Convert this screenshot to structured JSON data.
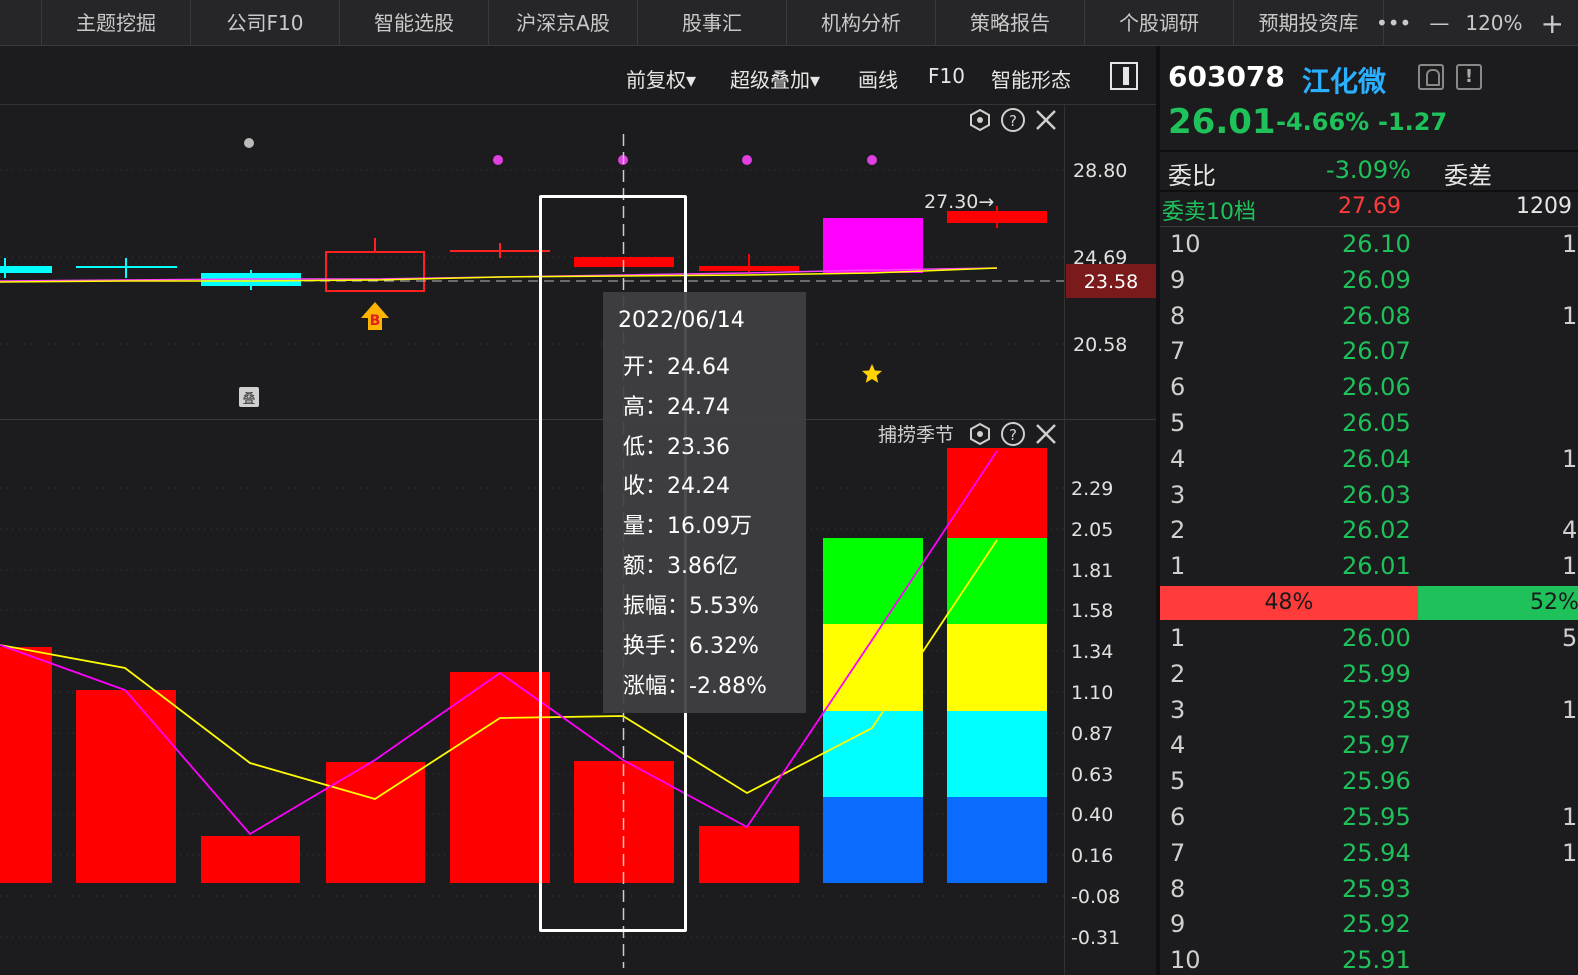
{
  "nav": {
    "tabs": [
      "主题挖掘",
      "公司F10",
      "智能选股",
      "沪深京A股",
      "股事汇",
      "机构分析",
      "策略报告",
      "个股调研",
      "预期投资库"
    ],
    "more": "•••",
    "zoom_out": "—",
    "zoom": "120%",
    "zoom_in": "+"
  },
  "toolbar": {
    "adjust": "前复权▾",
    "overlay": "超级叠加▾",
    "draw": "画线",
    "f10": "F10",
    "pattern": "智能形态"
  },
  "price_panel": {
    "y_ticks": [
      "28.80",
      "24.69",
      "20.58"
    ],
    "current_price_tag": "23.58",
    "annotation": "27.30→",
    "b_marker": "B",
    "stack_marker": "叠"
  },
  "indicator_panel": {
    "title": "捕捞季节",
    "y_ticks": [
      "2.29",
      "2.05",
      "1.81",
      "1.58",
      "1.34",
      "1.10",
      "0.87",
      "0.63",
      "0.40",
      "0.16",
      "-0.08",
      "-0.31"
    ]
  },
  "tooltip": {
    "date": "2022/06/14",
    "rows": [
      {
        "label": "开：",
        "value": "24.64"
      },
      {
        "label": "高：",
        "value": "24.74"
      },
      {
        "label": "低：",
        "value": "23.36"
      },
      {
        "label": "收：",
        "value": "24.24"
      },
      {
        "label": "量：",
        "value": "16.09万"
      },
      {
        "label": "额：",
        "value": "3.86亿"
      },
      {
        "label": "振幅：",
        "value": "5.53%"
      },
      {
        "label": "换手：",
        "value": "6.32%"
      },
      {
        "label": "涨幅：",
        "value": "-2.88%"
      }
    ]
  },
  "stock": {
    "code": "603078",
    "name": "江化微",
    "price": "26.01",
    "change_pct": "-4.66%",
    "change": "-1.27",
    "weibi_label": "委比",
    "weibi_value": "-3.09%",
    "weicha_label": "委差",
    "sell10_label": "委卖10档",
    "sell10_price": "27.69",
    "sell10_volume": "1209",
    "sells": [
      {
        "level": "10",
        "price": "26.10",
        "vol": "1"
      },
      {
        "level": "9",
        "price": "26.09",
        "vol": ""
      },
      {
        "level": "8",
        "price": "26.08",
        "vol": "1"
      },
      {
        "level": "7",
        "price": "26.07",
        "vol": ""
      },
      {
        "level": "6",
        "price": "26.06",
        "vol": ""
      },
      {
        "level": "5",
        "price": "26.05",
        "vol": ""
      },
      {
        "level": "4",
        "price": "26.04",
        "vol": "1"
      },
      {
        "level": "3",
        "price": "26.03",
        "vol": ""
      },
      {
        "level": "2",
        "price": "26.02",
        "vol": "4"
      },
      {
        "level": "1",
        "price": "26.01",
        "vol": "1"
      }
    ],
    "buy_ratio": "48%",
    "sell_ratio": "52%",
    "buys": [
      {
        "level": "1",
        "price": "26.00",
        "vol": "5"
      },
      {
        "level": "2",
        "price": "25.99",
        "vol": ""
      },
      {
        "level": "3",
        "price": "25.98",
        "vol": "1"
      },
      {
        "level": "4",
        "price": "25.97",
        "vol": ""
      },
      {
        "level": "5",
        "price": "25.96",
        "vol": ""
      },
      {
        "level": "6",
        "price": "25.95",
        "vol": "1"
      },
      {
        "level": "7",
        "price": "25.94",
        "vol": "1"
      },
      {
        "level": "8",
        "price": "25.93",
        "vol": ""
      },
      {
        "level": "9",
        "price": "25.92",
        "vol": ""
      },
      {
        "level": "10",
        "price": "25.91",
        "vol": ""
      }
    ]
  },
  "colors": {
    "up": "#ff0000",
    "down": "#00ffff",
    "magenta": "#ff00ff",
    "yellow": "#ffff00",
    "green_text": "#1ec15a",
    "blue_name": "#2ab0ff"
  }
}
